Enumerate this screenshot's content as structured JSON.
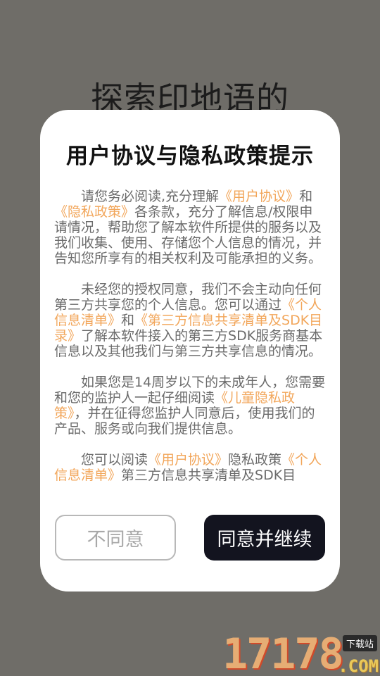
{
  "background": {
    "title": "探索印地语的"
  },
  "dialog": {
    "title": "用户协议与隐私政策提示",
    "paragraphs": [
      {
        "segments": [
          {
            "text": "请您务必阅读,充分理解",
            "link": false
          },
          {
            "text": "《用户协议》",
            "link": true
          },
          {
            "text": "和",
            "link": false
          },
          {
            "text": "《隐私政策》",
            "link": true
          },
          {
            "text": "各条款，充分了解信息/权限申请情况，帮助您了解本软件所提供的服务以及我们收集、使用、存储您个人信息的情况，并告知您所享有的相关权利及可能承担的义务。",
            "link": false
          }
        ]
      },
      {
        "segments": [
          {
            "text": "未经您的授权同意，我们不会主动向任何第三方共享您的个人信息。您可以通过",
            "link": false
          },
          {
            "text": "《个人信息清单》",
            "link": true
          },
          {
            "text": "和",
            "link": false
          },
          {
            "text": "《第三方信息共享清单及SDK目录》",
            "link": true
          },
          {
            "text": "了解本软件接入的第三方SDK服务商基本信息以及其他我们与第三方共享信息的情况。",
            "link": false
          }
        ]
      },
      {
        "segments": [
          {
            "text": "如果您是14周岁以下的未成年人，您需要和您的监护人一起仔细阅读",
            "link": false
          },
          {
            "text": "《儿童隐私政策》",
            "link": true
          },
          {
            "text": "，并在征得您监护人同意后，使用我们的产品、服务或向我们提供信息。",
            "link": false
          }
        ]
      },
      {
        "segments": [
          {
            "text": "您可以阅读",
            "link": false
          },
          {
            "text": "《用户协议》",
            "link": true
          },
          {
            "text": "隐私政策",
            "link": false
          },
          {
            "text": "《个人信息清单》",
            "link": true
          },
          {
            "text": "第三方信息共享清单及SDK目",
            "link": false
          }
        ]
      }
    ],
    "disagree_label": "不同意",
    "agree_label": "同意并继续"
  },
  "watermark": {
    "digits": "17178",
    "tag": "下载站",
    "suffix": ".COM"
  },
  "colors": {
    "overlay": "#6f6d68",
    "link": "#f2a65a",
    "agree_bg": "#13141f",
    "body_text": "#6b6b6b"
  }
}
